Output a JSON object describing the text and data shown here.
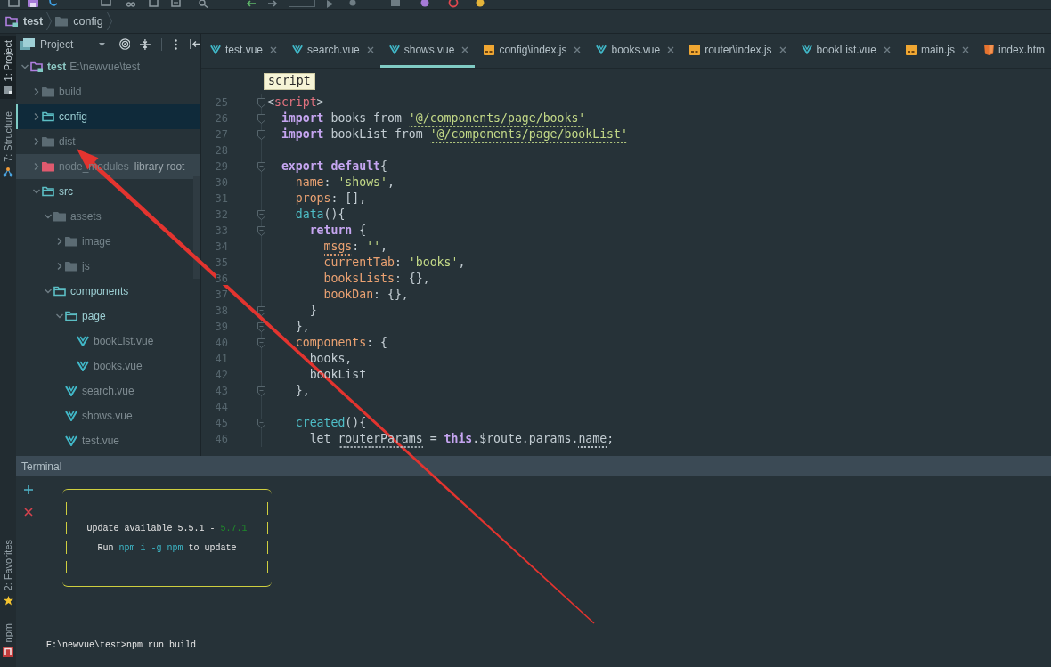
{
  "breadcrumb": [
    {
      "label": "test",
      "kind": "module"
    },
    {
      "label": "config",
      "kind": "folder"
    }
  ],
  "tool_strip": {
    "top": [
      {
        "label": "1: Project",
        "kind": "project",
        "selected": true
      },
      {
        "label": "7: Structure",
        "kind": "structure",
        "selected": false
      }
    ],
    "bottom": [
      {
        "label": "2: Favorites",
        "kind": "favorites",
        "selected": false
      },
      {
        "label": "npm",
        "kind": "npm",
        "selected": false
      }
    ]
  },
  "project_panel": {
    "title": "Project",
    "tree": [
      {
        "label": "test",
        "kind": "module",
        "path": "E:\\newvue\\test",
        "expanded": true,
        "selected": false,
        "hovered": false,
        "children": [
          {
            "label": "build",
            "kind": "folder",
            "expanded": false,
            "selected": false,
            "hovered": false
          },
          {
            "label": "config",
            "kind": "source-folder",
            "expanded": false,
            "selected": true,
            "hovered": false
          },
          {
            "label": "dist",
            "kind": "folder",
            "expanded": false,
            "selected": false,
            "hovered": false
          },
          {
            "label": "node_modules",
            "kind": "library",
            "note": "library root",
            "expanded": false,
            "selected": false,
            "hovered": true
          },
          {
            "label": "src",
            "kind": "source-folder",
            "expanded": true,
            "selected": false,
            "hovered": false,
            "children": [
              {
                "label": "assets",
                "kind": "folder",
                "expanded": true,
                "selected": false,
                "hovered": false,
                "children": [
                  {
                    "label": "image",
                    "kind": "folder",
                    "expanded": false,
                    "selected": false,
                    "hovered": false
                  },
                  {
                    "label": "js",
                    "kind": "folder",
                    "expanded": false,
                    "selected": false,
                    "hovered": false
                  }
                ]
              },
              {
                "label": "components",
                "kind": "source-folder",
                "expanded": true,
                "selected": false,
                "hovered": false,
                "children": [
                  {
                    "label": "page",
                    "kind": "source-folder",
                    "expanded": true,
                    "selected": false,
                    "hovered": false,
                    "children": [
                      {
                        "label": "bookList.vue",
                        "kind": "vue-file",
                        "expanded": false,
                        "selected": false,
                        "hovered": false
                      },
                      {
                        "label": "books.vue",
                        "kind": "vue-file",
                        "expanded": false,
                        "selected": false,
                        "hovered": false
                      }
                    ]
                  },
                  {
                    "label": "search.vue",
                    "kind": "vue-file",
                    "expanded": false,
                    "selected": false,
                    "hovered": false
                  },
                  {
                    "label": "shows.vue",
                    "kind": "vue-file",
                    "expanded": false,
                    "selected": false,
                    "hovered": false
                  },
                  {
                    "label": "test.vue",
                    "kind": "vue-file",
                    "expanded": false,
                    "selected": false,
                    "hovered": false
                  }
                ]
              }
            ]
          }
        ]
      }
    ]
  },
  "editor": {
    "tabs": [
      {
        "label": "test.vue",
        "kind": "vue",
        "selected": false
      },
      {
        "label": "search.vue",
        "kind": "vue",
        "selected": false
      },
      {
        "label": "shows.vue",
        "kind": "vue",
        "selected": true
      },
      {
        "label": "config\\index.js",
        "kind": "js",
        "selected": false
      },
      {
        "label": "books.vue",
        "kind": "vue",
        "selected": false
      },
      {
        "label": "router\\index.js",
        "kind": "js",
        "selected": false
      },
      {
        "label": "bookList.vue",
        "kind": "vue",
        "selected": false
      },
      {
        "label": "main.js",
        "kind": "js",
        "selected": false
      },
      {
        "label": "index.htm",
        "kind": "html",
        "selected": false
      }
    ],
    "tooltip": "script",
    "lines": [
      {
        "number": "25",
        "fold": true,
        "tokens": [
          {
            "kind": "punct",
            "text": "<",
            "wavy": false
          },
          {
            "kind": "tag",
            "text": "script",
            "wavy": false
          },
          {
            "kind": "punct",
            "text": ">",
            "wavy": false
          }
        ]
      },
      {
        "number": "26",
        "fold": true,
        "tokens": [
          {
            "kind": "keyword",
            "text": "  import",
            "wavy": false
          },
          {
            "kind": "plain",
            "text": " books from ",
            "wavy": false
          },
          {
            "kind": "string",
            "text": "'@/components/page/books'",
            "wavy": true
          }
        ]
      },
      {
        "number": "27",
        "fold": true,
        "tokens": [
          {
            "kind": "keyword",
            "text": "  import",
            "wavy": false
          },
          {
            "kind": "plain",
            "text": " bookList from ",
            "wavy": false
          },
          {
            "kind": "string",
            "text": "'@/components/page/bookList'",
            "wavy": true
          }
        ]
      },
      {
        "number": "28",
        "fold": false
      },
      {
        "number": "29",
        "fold": true,
        "tokens": [
          {
            "kind": "keyword",
            "text": "  export default",
            "wavy": false
          },
          {
            "kind": "plain",
            "text": "{",
            "wavy": false
          }
        ]
      },
      {
        "number": "30",
        "fold": false,
        "tokens": [
          {
            "kind": "property",
            "text": "    name",
            "wavy": false
          },
          {
            "kind": "plain",
            "text": ": ",
            "wavy": false
          },
          {
            "kind": "string",
            "text": "'shows'",
            "wavy": false
          },
          {
            "kind": "plain",
            "text": ",",
            "wavy": false
          }
        ]
      },
      {
        "number": "31",
        "fold": false,
        "tokens": [
          {
            "kind": "property",
            "text": "    props",
            "wavy": false
          },
          {
            "kind": "plain",
            "text": ": [],",
            "wavy": false
          }
        ]
      },
      {
        "number": "32",
        "fold": true,
        "tokens": [
          {
            "kind": "function",
            "text": "    data",
            "wavy": false
          },
          {
            "kind": "plain",
            "text": "(){",
            "wavy": false
          }
        ]
      },
      {
        "number": "33",
        "fold": true,
        "tokens": [
          {
            "kind": "keyword",
            "text": "      return",
            "wavy": false
          },
          {
            "kind": "plain",
            "text": " {",
            "wavy": false
          }
        ]
      },
      {
        "number": "34",
        "fold": false,
        "tokens": [
          {
            "kind": "property",
            "text": "        msgs",
            "wavy": true
          },
          {
            "kind": "plain",
            "text": ": ",
            "wavy": false
          },
          {
            "kind": "string",
            "text": "''",
            "wavy": false
          },
          {
            "kind": "plain",
            "text": ",",
            "wavy": false
          }
        ]
      },
      {
        "number": "35",
        "fold": false,
        "tokens": [
          {
            "kind": "property",
            "text": "        currentTab",
            "wavy": false
          },
          {
            "kind": "plain",
            "text": ": ",
            "wavy": false
          },
          {
            "kind": "string",
            "text": "'books'",
            "wavy": false
          },
          {
            "kind": "plain",
            "text": ",",
            "wavy": false
          }
        ]
      },
      {
        "number": "36",
        "fold": false,
        "tokens": [
          {
            "kind": "property",
            "text": "        booksLists",
            "wavy": false
          },
          {
            "kind": "plain",
            "text": ": {},",
            "wavy": false
          }
        ]
      },
      {
        "number": "37",
        "fold": false,
        "tokens": [
          {
            "kind": "property",
            "text": "        bookDan",
            "wavy": false
          },
          {
            "kind": "plain",
            "text": ": {},",
            "wavy": false
          }
        ]
      },
      {
        "number": "38",
        "fold": true,
        "tokens": [
          {
            "kind": "plain",
            "text": "      }",
            "wavy": false
          }
        ]
      },
      {
        "number": "39",
        "fold": true,
        "tokens": [
          {
            "kind": "plain",
            "text": "    },",
            "wavy": false
          }
        ]
      },
      {
        "number": "40",
        "fold": true,
        "tokens": [
          {
            "kind": "property",
            "text": "    components",
            "wavy": false
          },
          {
            "kind": "plain",
            "text": ": {",
            "wavy": false
          }
        ]
      },
      {
        "number": "41",
        "fold": false,
        "tokens": [
          {
            "kind": "plain",
            "text": "      books,",
            "wavy": false
          }
        ]
      },
      {
        "number": "42",
        "fold": false,
        "tokens": [
          {
            "kind": "plain",
            "text": "      bookList",
            "wavy": false
          }
        ]
      },
      {
        "number": "43",
        "fold": true,
        "tokens": [
          {
            "kind": "plain",
            "text": "    },",
            "wavy": false
          }
        ]
      },
      {
        "number": "44",
        "fold": false
      },
      {
        "number": "45",
        "fold": true,
        "tokens": [
          {
            "kind": "function",
            "text": "    created",
            "wavy": false
          },
          {
            "kind": "plain",
            "text": "(){",
            "wavy": false
          }
        ]
      },
      {
        "number": "46",
        "fold": false,
        "tokens": [
          {
            "kind": "plain",
            "text": "      let ",
            "wavy": false
          },
          {
            "kind": "plain",
            "text": "routerParams",
            "wavy": true
          },
          {
            "kind": "plain",
            "text": " = ",
            "wavy": false
          },
          {
            "kind": "keyword",
            "text": "this",
            "wavy": false
          },
          {
            "kind": "plain",
            "text": ".$route.params.",
            "wavy": false
          },
          {
            "kind": "plain",
            "text": "name",
            "wavy": true
          },
          {
            "kind": "plain",
            "text": ";",
            "wavy": false
          }
        ]
      }
    ]
  },
  "terminal": {
    "title": "Terminal",
    "notice": [
      [
        {
          "kind": "plain",
          "text": "Update available 5.5.1 - "
        },
        {
          "kind": "new-version",
          "text": "5.7.1"
        }
      ],
      [
        {
          "kind": "plain",
          "text": "Run "
        },
        {
          "kind": "command",
          "text": "npm i -g npm"
        },
        {
          "kind": "plain",
          "text": " to update"
        }
      ]
    ],
    "prompt": "E:\\newvue\\test>npm run build"
  },
  "annotations": [
    {
      "kind": "arrow"
    }
  ]
}
